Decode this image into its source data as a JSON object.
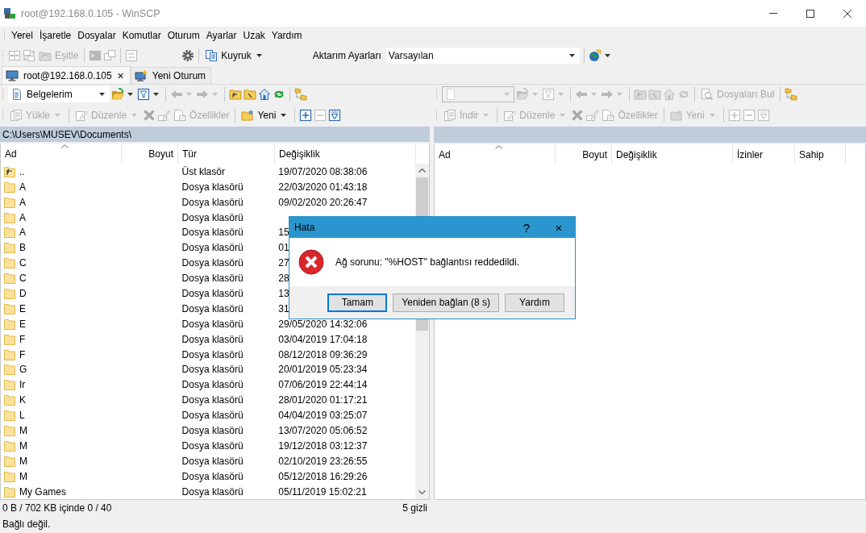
{
  "window": {
    "title": "root@192.168.0.105 - WinSCP"
  },
  "menu": [
    "Yerel",
    "İşaretle",
    "Dosyalar",
    "Komutlar",
    "Oturum",
    "Ayarlar",
    "Uzak",
    "Yardım"
  ],
  "toolbar": [
    {
      "kind": "button",
      "disabled": true,
      "dropdown": false
    },
    {
      "kind": "button",
      "disabled": true,
      "dropdown": false
    },
    {
      "kind": "button",
      "label": "Eşitle",
      "disabled": true,
      "dropdown": false
    },
    {
      "kind": "separator"
    },
    {
      "kind": "button",
      "disabled": true,
      "dropdown": false
    },
    {
      "kind": "button",
      "disabled": true,
      "dropdown": false
    },
    {
      "kind": "separator"
    },
    {
      "kind": "button",
      "disabled": true,
      "dropdown": false
    },
    {
      "kind": "gap"
    },
    {
      "kind": "button",
      "disabled": false,
      "dropdown": false
    },
    {
      "kind": "separator"
    },
    {
      "kind": "button",
      "label": "Kuyruk",
      "disabled": false,
      "dropdown": true
    },
    {
      "kind": "gap"
    },
    {
      "kind": "text",
      "label": "Aktarım Ayarları"
    },
    {
      "kind": "combo",
      "value": "Varsayılan",
      "disabled": false
    },
    {
      "kind": "separator"
    },
    {
      "kind": "button",
      "disabled": false,
      "dropdown": true
    }
  ],
  "tabs": [
    {
      "label": "root@192.168.0.105",
      "selected": true,
      "close": "×"
    },
    {
      "label": "Yeni Oturum",
      "selected": false
    }
  ],
  "left_panel": {
    "toolbar_1": [
      {
        "kind": "combo",
        "value": "Belgelerim",
        "disabled": false
      },
      {
        "kind": "button",
        "disabled": false,
        "dropdown": true
      },
      {
        "kind": "button",
        "disabled": false,
        "dropdown": true
      },
      {
        "kind": "separator"
      },
      {
        "kind": "button",
        "disabled": true,
        "dropdown": true
      },
      {
        "kind": "button",
        "disabled": true,
        "dropdown": true
      },
      {
        "kind": "separator"
      },
      {
        "kind": "button",
        "disabled": false,
        "dropdown": false
      },
      {
        "kind": "button",
        "disabled": false,
        "dropdown": false
      },
      {
        "kind": "button",
        "disabled": false,
        "dropdown": false
      },
      {
        "kind": "button",
        "disabled": false,
        "dropdown": false
      },
      {
        "kind": "separator"
      },
      {
        "kind": "button",
        "disabled": false,
        "dropdown": false
      }
    ],
    "toolbar_2": [
      {
        "kind": "button",
        "label": "Yükle",
        "disabled": true,
        "dropdown": true
      },
      {
        "kind": "separator"
      },
      {
        "kind": "button",
        "label": "Düzenle",
        "disabled": true,
        "dropdown": true
      },
      {
        "kind": "button",
        "disabled": true,
        "dropdown": false
      },
      {
        "kind": "button",
        "disabled": true,
        "dropdown": false
      },
      {
        "kind": "button",
        "label": "Özellikler",
        "disabled": true,
        "dropdown": false
      },
      {
        "kind": "separator"
      },
      {
        "kind": "button",
        "label": "Yeni",
        "disabled": false,
        "dropdown": true
      },
      {
        "kind": "separator"
      },
      {
        "kind": "button",
        "disabled": false,
        "dropdown": false
      },
      {
        "kind": "button",
        "disabled": true,
        "dropdown": false
      },
      {
        "kind": "button",
        "disabled": false,
        "dropdown": false
      }
    ],
    "path": "C:\\Users\\MUSEV\\Documents\\",
    "columns": [
      {
        "label": "Ad",
        "sorted": true
      },
      {
        "label": "Boyut",
        "sorted": false
      },
      {
        "label": "Tür",
        "sorted": false
      },
      {
        "label": "Değişiklik",
        "sorted": false
      }
    ],
    "rows": [
      {
        "kind": "parent",
        "name": "..",
        "type": "Üst klasör",
        "modified": "19/07/2020  08:38:06"
      },
      {
        "kind": "folder",
        "name": "A",
        "type": "Dosya klasörü",
        "modified": "22/03/2020  01:43:18"
      },
      {
        "kind": "folder",
        "name": "A",
        "type": "Dosya klasörü",
        "modified": "09/02/2020  20:26:47"
      },
      {
        "kind": "folder",
        "name": "A",
        "type": "Dosya klasörü"
      },
      {
        "kind": "folder",
        "name": "A",
        "type": "Dosya klasörü",
        "modified": "15"
      },
      {
        "kind": "folder",
        "name": "B",
        "type": "Dosya klasörü",
        "modified": "01"
      },
      {
        "kind": "folder",
        "name": "C",
        "type": "Dosya klasörü",
        "modified": "27"
      },
      {
        "kind": "folder",
        "name": "C",
        "type": "Dosya klasörü",
        "modified": "28"
      },
      {
        "kind": "folder",
        "name": "D",
        "type": "Dosya klasörü",
        "modified": "13"
      },
      {
        "kind": "folder",
        "name": "E",
        "type": "Dosya klasörü",
        "modified": "31"
      },
      {
        "kind": "folder",
        "name": "E",
        "type": "Dosya klasörü",
        "modified": "29/05/2020  14:32:06"
      },
      {
        "kind": "folder",
        "name": "F",
        "type": "Dosya klasörü",
        "modified": "03/04/2019  17:04:18"
      },
      {
        "kind": "folder",
        "name": "F",
        "type": "Dosya klasörü",
        "modified": "08/12/2018  09:36:29"
      },
      {
        "kind": "folder",
        "name": "G",
        "type": "Dosya klasörü",
        "modified": "20/01/2019  05:23:34"
      },
      {
        "kind": "folder",
        "name": "Ir",
        "type": "Dosya klasörü",
        "modified": "07/06/2019  22:44:14"
      },
      {
        "kind": "folder",
        "name": "K",
        "type": "Dosya klasörü",
        "modified": "28/01/2020  01:17:21"
      },
      {
        "kind": "folder",
        "name": "L",
        "type": "Dosya klasörü",
        "modified": "04/04/2019  03:25:07"
      },
      {
        "kind": "folder",
        "name": "M",
        "type": "Dosya klasörü",
        "modified": "13/07/2020  05:06:52"
      },
      {
        "kind": "folder",
        "name": "M",
        "type": "Dosya klasörü",
        "modified": "19/12/2018  03:12:37"
      },
      {
        "kind": "folder",
        "name": "M",
        "type": "Dosya klasörü",
        "modified": "02/10/2019  23:26:55"
      },
      {
        "kind": "folder",
        "name": "M",
        "type": "Dosya klasörü",
        "modified": "05/12/2018  16:29:26"
      },
      {
        "kind": "folder",
        "name": "My Games",
        "type": "Dosya klasörü",
        "modified": "05/11/2019  15:02:21"
      }
    ],
    "status": "0 B / 702 KB içinde 0 / 40",
    "hidden": "5 gizli"
  },
  "right_panel": {
    "toolbar_1": [
      {
        "kind": "combo",
        "disabled": true
      },
      {
        "kind": "button",
        "disabled": true,
        "dropdown": true
      },
      {
        "kind": "button",
        "disabled": true,
        "dropdown": true
      },
      {
        "kind": "separator"
      },
      {
        "kind": "button",
        "disabled": true,
        "dropdown": true
      },
      {
        "kind": "button",
        "disabled": true,
        "dropdown": true
      },
      {
        "kind": "separator"
      },
      {
        "kind": "button",
        "disabled": true,
        "dropdown": false
      },
      {
        "kind": "button",
        "disabled": true,
        "dropdown": false
      },
      {
        "kind": "button",
        "disabled": true,
        "dropdown": false
      },
      {
        "kind": "button",
        "disabled": true,
        "dropdown": false
      },
      {
        "kind": "separator"
      },
      {
        "kind": "button",
        "label": "Dosyaları Bul",
        "disabled": true,
        "dropdown": false
      },
      {
        "kind": "separator"
      },
      {
        "kind": "button",
        "disabled": false,
        "dropdown": false
      }
    ],
    "toolbar_2": [
      {
        "kind": "button",
        "label": "İndir",
        "disabled": true,
        "dropdown": true
      },
      {
        "kind": "separator"
      },
      {
        "kind": "button",
        "label": "Düzenle",
        "disabled": true,
        "dropdown": true
      },
      {
        "kind": "button",
        "disabled": true,
        "dropdown": false
      },
      {
        "kind": "button",
        "disabled": true,
        "dropdown": false
      },
      {
        "kind": "button",
        "label": "Özellikler",
        "disabled": true,
        "dropdown": false
      },
      {
        "kind": "separator"
      },
      {
        "kind": "button",
        "label": "Yeni",
        "disabled": true,
        "dropdown": true
      },
      {
        "kind": "separator"
      },
      {
        "kind": "button",
        "disabled": true,
        "dropdown": false
      },
      {
        "kind": "button",
        "disabled": true,
        "dropdown": false
      },
      {
        "kind": "button",
        "disabled": true,
        "dropdown": false
      }
    ],
    "columns": [
      {
        "label": "Ad",
        "sorted": true
      },
      {
        "label": "Boyut",
        "sorted": false
      },
      {
        "label": "Değişiklik",
        "sorted": false
      },
      {
        "label": "İzinler",
        "sorted": false
      },
      {
        "label": "Sahip",
        "sorted": false
      }
    ]
  },
  "status_bar": "Bağlı değil.",
  "dialog": {
    "title": "Hata",
    "help": "?",
    "close": "×",
    "message": "Ağ sorunu: \"%HOST\" bağlantısı reddedildi.",
    "buttons": [
      {
        "label": "Tamam",
        "default": true
      },
      {
        "label": "Yeniden bağlan (8 s)",
        "default": false
      },
      {
        "label": "Yardım",
        "default": false
      }
    ]
  }
}
